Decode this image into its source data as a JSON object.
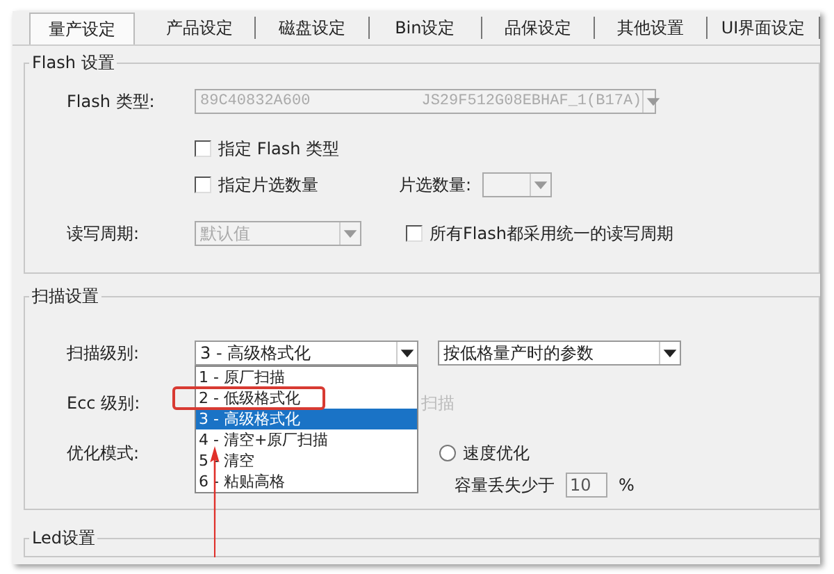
{
  "tabs": [
    {
      "label": "量产设定",
      "selected": true
    },
    {
      "label": "产品设定",
      "selected": false
    },
    {
      "label": "磁盘设定",
      "selected": false
    },
    {
      "label": "Bin设定",
      "selected": false
    },
    {
      "label": "品保设定",
      "selected": false
    },
    {
      "label": "其他设置",
      "selected": false
    },
    {
      "label": "UI界面设定",
      "selected": false
    }
  ],
  "flash_settings": {
    "title": "Flash 设置",
    "flash_type": {
      "label": "Flash 类型:",
      "id": "89C40832A600",
      "part": "JS29F512G08EBHAF_1(B17A)",
      "disabled": true
    },
    "checkboxes": [
      {
        "label": "指定 Flash 类型",
        "checked": false
      },
      {
        "label": "指定片选数量",
        "checked": false
      }
    ],
    "chip_select": {
      "label": "片选数量:",
      "disabled": true
    },
    "rw_cycle": {
      "label": "读写周期:",
      "value": "默认值",
      "disabled": true
    },
    "unified_cycle": {
      "label": "所有Flash都采用统一的读写周期",
      "checked": false
    }
  },
  "scan_settings": {
    "title": "扫描设置",
    "scan_level": {
      "label": "扫描级别:",
      "value": "3 - 高级格式化",
      "expanded": true,
      "options": [
        {
          "label": "1 - 原厂扫描",
          "selected": false,
          "highlighted": false
        },
        {
          "label": "2 - 低级格式化",
          "selected": false,
          "highlighted": true
        },
        {
          "label": "3 - 高级格式化",
          "selected": true,
          "highlighted": false
        },
        {
          "label": "4 - 清空+原厂扫描",
          "selected": false,
          "highlighted": false
        },
        {
          "label": "5 - 清空",
          "selected": false,
          "highlighted": false
        },
        {
          "label": "6 - 粘贴高格",
          "selected": false,
          "highlighted": false
        }
      ]
    },
    "param_select": {
      "value": "按低格量产时的参数"
    },
    "ecc": {
      "label": "Ecc 级别:",
      "option_label": "扫描",
      "disabled": true
    },
    "optimize": {
      "label": "优化模式:",
      "options": [
        {
          "label": "速度优化",
          "selected": false
        }
      ]
    },
    "capacity_loss": {
      "label": "容量丢失少于",
      "value": "10",
      "unit": "%",
      "disabled": true
    }
  },
  "led_settings": {
    "title": "Led设置"
  }
}
